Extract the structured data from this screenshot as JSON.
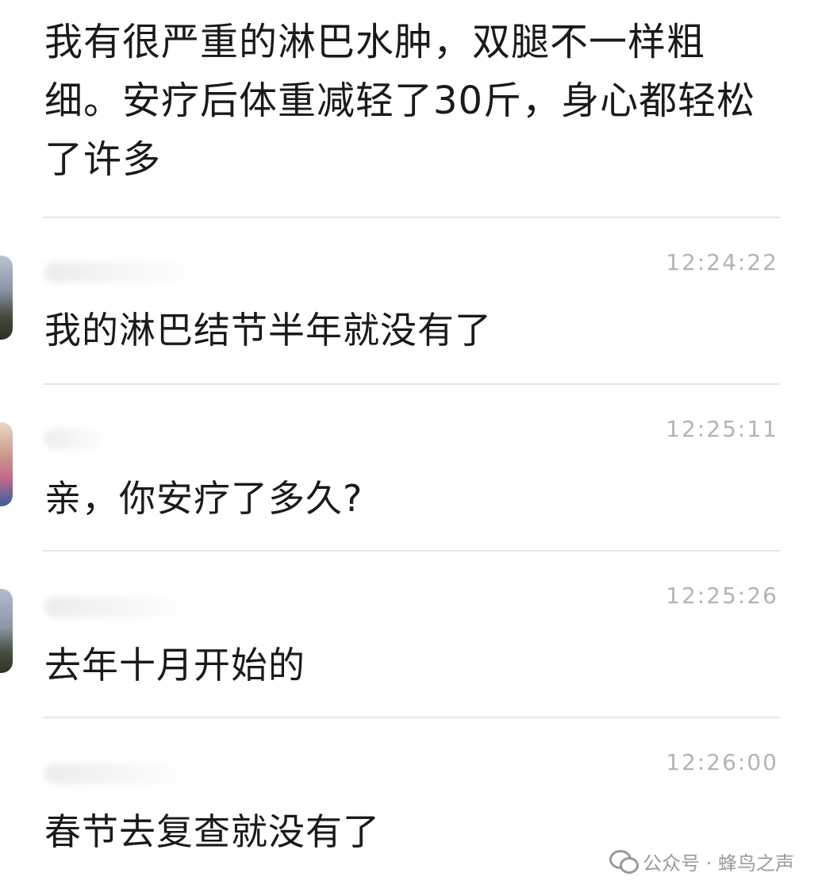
{
  "top_comment": {
    "text": "我有很严重的淋巴水肿，双腿不一样粗细。安疗后体重减轻了30斤，身心都轻松了许多"
  },
  "comments": [
    {
      "time": "12:24:22",
      "text": "我的淋巴结节半年就没有了"
    },
    {
      "time": "12:25:11",
      "text": "亲，你安疗了多久?"
    },
    {
      "time": "12:25:26",
      "text": "去年十月开始的"
    },
    {
      "time": "12:26:00",
      "text": "春节去复查就没有了"
    }
  ],
  "watermark": {
    "icon": "wechat-icon",
    "text": "公众号 · 蜂鸟之声"
  },
  "colors": {
    "text": "#1a1a1a",
    "timestamp": "#b3b3b3",
    "divider": "#e6e6e6",
    "watermark": "#9a9a9a"
  }
}
